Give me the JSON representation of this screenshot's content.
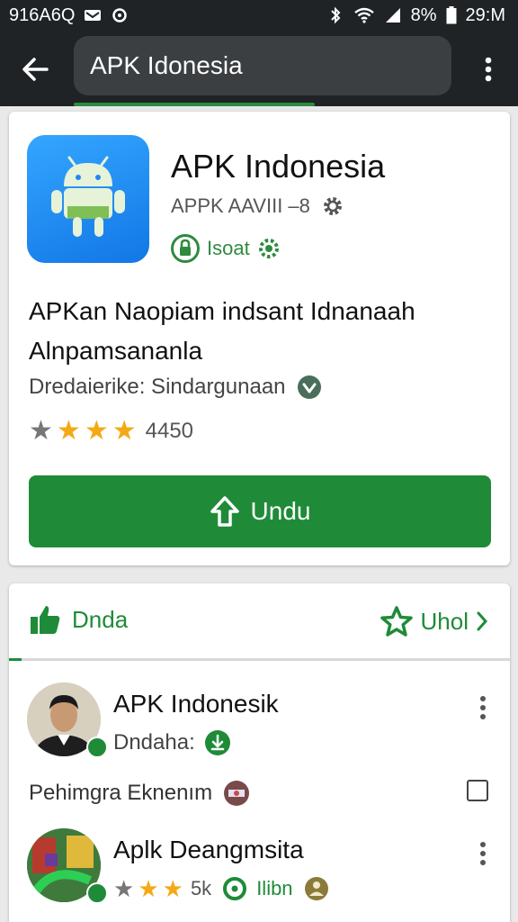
{
  "status_bar": {
    "left_text": "916A6Q",
    "battery": "8%",
    "time": "29:M"
  },
  "app_bar": {
    "search_text": "APK Idonesia",
    "back_icon": "arrow-left-icon",
    "overflow_icon": "more-vert-icon"
  },
  "app_card": {
    "title": "APK Indonesia",
    "developer": "APPK AAVIII –8",
    "install_badge": "Isoat",
    "description": "APKan Naopiam indsant Idnanaah Alnpamsananla",
    "category": "Dredaierike: Sindargunaan",
    "rating_stars": 3,
    "rating_count": "4450",
    "download_label": "Undu",
    "colors": {
      "accent": "#1f8b38",
      "icon_bg": "#1e88f5",
      "star": "#f4a916"
    }
  },
  "list_card": {
    "tab_left_label": "Dnda",
    "tab_right_label": "Uhol",
    "rows": [
      {
        "title": "APK Indonesik",
        "subtitle": "Dndaha:"
      },
      {
        "title": "Aplk Deangmsita",
        "rating_stars": 2,
        "count": "5k",
        "badge_text": "Ilibn"
      }
    ],
    "info_text": "Pehimgra Eknenım"
  }
}
